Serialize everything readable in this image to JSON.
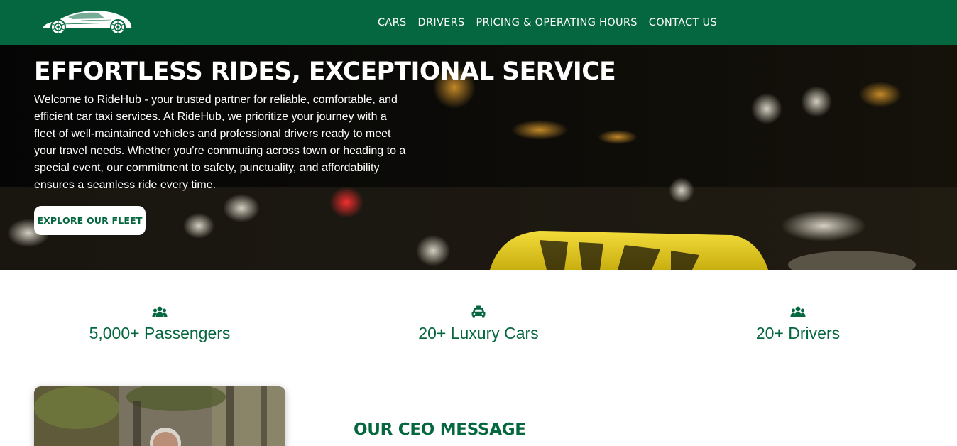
{
  "brand": {
    "logo_icon": "sports-car-icon"
  },
  "nav": {
    "items": [
      {
        "label": "CARS"
      },
      {
        "label": "DRIVERS"
      },
      {
        "label": "PRICING & OPERATING HOURS"
      },
      {
        "label": "CONTACT US"
      }
    ]
  },
  "hero": {
    "title": "EFFORTLESS RIDES, EXCEPTIONAL SERVICE",
    "text": "Welcome to RideHub - your trusted partner for reliable, comfortable, and efficient car taxi services. At RideHub, we prioritize your journey with a fleet of well-maintained vehicles and professional drivers ready to meet your travel needs. Whether you're commuting across town or heading to a special event, our commitment to safety, punctuality, and affordability ensures a seamless ride every time.",
    "button_label": "EXPLORE OUR FLEET",
    "background": "taxi-sign-night-photo"
  },
  "stats": [
    {
      "icon": "users-icon",
      "label": "5,000+ Passengers"
    },
    {
      "icon": "taxi-icon",
      "label": "20+ Luxury Cars"
    },
    {
      "icon": "users-icon",
      "label": "20+ Drivers"
    }
  ],
  "ceo": {
    "title": "OUR CEO MESSAGE",
    "photo": "ceo-portrait-photo"
  },
  "colors": {
    "brand_green": "#05673f",
    "white": "#ffffff",
    "taxi_yellow": "#e8d21a"
  }
}
